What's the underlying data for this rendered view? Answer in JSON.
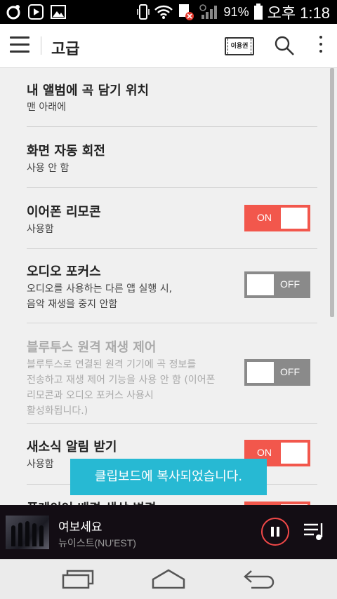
{
  "status_bar": {
    "battery_percent": "91%",
    "time": "오후 1:18"
  },
  "header": {
    "title": "고급",
    "ticket_label": "이용권"
  },
  "settings": [
    {
      "title": "내 앨범에 곡 담기 위치",
      "subtitle": "맨 아래에",
      "toggle": null,
      "enabled": true
    },
    {
      "title": "화면 자동 회전",
      "subtitle": "사용 안 함",
      "toggle": null,
      "enabled": true
    },
    {
      "title": "이어폰 리모콘",
      "subtitle": "사용함",
      "toggle": "ON",
      "enabled": true
    },
    {
      "title": "오디오 포커스",
      "subtitle": "오디오를 사용하는 다른 앱 실행 시,\n음악 재생을 중지 안함",
      "toggle": "OFF",
      "enabled": true
    },
    {
      "title": "블루투스 원격 재생 제어",
      "subtitle": "블루투스로 연결된 원격 기기에 곡 정보를\n전송하고 재생 제어 기능을 사용 안 함 (이어폰\n리모콘과 오디오 포커스 사용시\n활성화됩니다.)",
      "toggle": "OFF",
      "enabled": false
    },
    {
      "title": "새소식 알림 받기",
      "subtitle": "사용함",
      "toggle": "ON",
      "enabled": true
    },
    {
      "title": "플레이어 배경 색상 변경",
      "subtitle": "",
      "toggle": "ON",
      "enabled": true
    }
  ],
  "toast": "클립보드에 복사되었습니다.",
  "player": {
    "song": "여보세요",
    "artist": "뉴이스트(NU'EST)"
  },
  "colors": {
    "accent": "#f2574c",
    "toast": "#27b9d3",
    "player_bg": "#130d14"
  }
}
